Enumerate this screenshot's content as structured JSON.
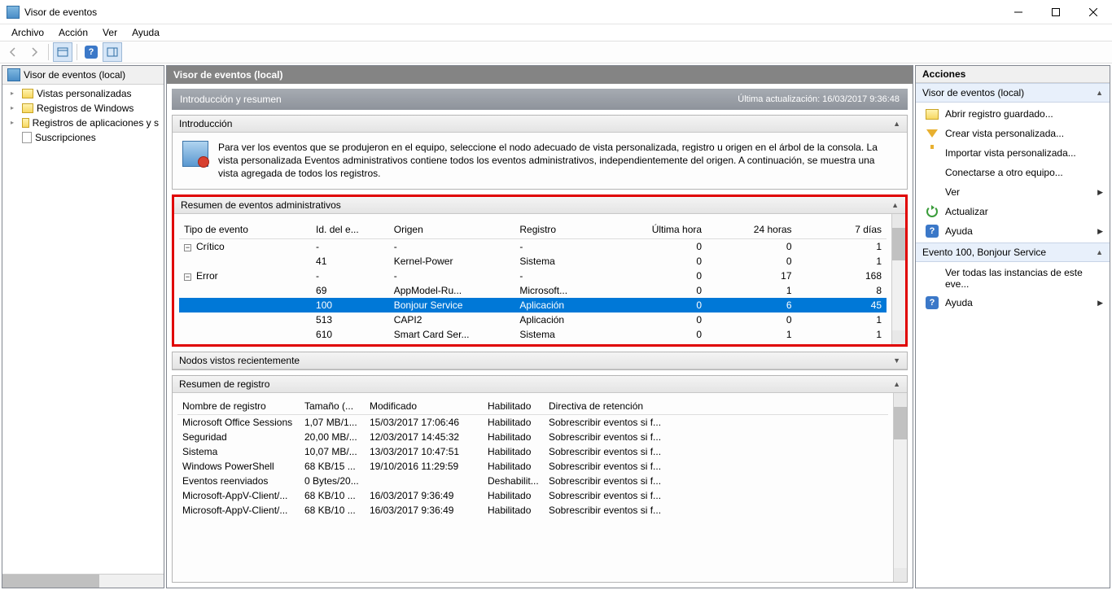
{
  "window": {
    "title": "Visor de eventos"
  },
  "menu": {
    "archivo": "Archivo",
    "accion": "Acción",
    "ver": "Ver",
    "ayuda": "Ayuda"
  },
  "tree": {
    "root": "Visor de eventos (local)",
    "items": [
      "Vistas personalizadas",
      "Registros de Windows",
      "Registros de aplicaciones y s",
      "Suscripciones"
    ]
  },
  "center": {
    "header": "Visor de eventos (local)",
    "title": "Introducción y resumen",
    "last_update": "Última actualización: 16/03/2017 9:36:48",
    "intro_header": "Introducción",
    "intro_text": "Para ver los eventos que se produjeron en el equipo, seleccione el nodo adecuado de vista personalizada, registro u origen en el árbol de la consola. La vista personalizada Eventos administrativos contiene todos los eventos administrativos, independientemente del origen. A continuación, se muestra una vista agregada de todos los registros.",
    "admin_summary_header": "Resumen de eventos administrativos",
    "admin_cols": {
      "tipo": "Tipo de evento",
      "id": "Id. del e...",
      "origen": "Origen",
      "registro": "Registro",
      "ultima": "Última hora",
      "h24": "24 horas",
      "d7": "7 días"
    },
    "admin_rows": [
      {
        "tipo": "Crítico",
        "id": "-",
        "origen": "-",
        "registro": "-",
        "ultima": "0",
        "h24": "0",
        "d7": "1",
        "expand": true
      },
      {
        "tipo": "",
        "id": "41",
        "origen": "Kernel-Power",
        "registro": "Sistema",
        "ultima": "0",
        "h24": "0",
        "d7": "1"
      },
      {
        "tipo": "Error",
        "id": "-",
        "origen": "-",
        "registro": "-",
        "ultima": "0",
        "h24": "17",
        "d7": "168",
        "expand": true
      },
      {
        "tipo": "",
        "id": "69",
        "origen": "AppModel-Ru...",
        "registro": "Microsoft...",
        "ultima": "0",
        "h24": "1",
        "d7": "8"
      },
      {
        "tipo": "",
        "id": "100",
        "origen": "Bonjour Service",
        "registro": "Aplicación",
        "ultima": "0",
        "h24": "6",
        "d7": "45",
        "selected": true
      },
      {
        "tipo": "",
        "id": "513",
        "origen": "CAPI2",
        "registro": "Aplicación",
        "ultima": "0",
        "h24": "0",
        "d7": "1"
      },
      {
        "tipo": "",
        "id": "610",
        "origen": "Smart Card Ser...",
        "registro": "Sistema",
        "ultima": "0",
        "h24": "1",
        "d7": "1"
      }
    ],
    "recent_nodes_header": "Nodos vistos recientemente",
    "reg_summary_header": "Resumen de registro",
    "reg_cols": {
      "nombre": "Nombre de registro",
      "tam": "Tamaño (...",
      "mod": "Modificado",
      "hab": "Habilitado",
      "dir": "Directiva de retención"
    },
    "reg_rows": [
      {
        "nombre": "Microsoft Office Sessions",
        "tam": "1,07 MB/1...",
        "mod": "15/03/2017 17:06:46",
        "hab": "Habilitado",
        "dir": "Sobrescribir eventos si f..."
      },
      {
        "nombre": "Seguridad",
        "tam": "20,00 MB/...",
        "mod": "12/03/2017 14:45:32",
        "hab": "Habilitado",
        "dir": "Sobrescribir eventos si f..."
      },
      {
        "nombre": "Sistema",
        "tam": "10,07 MB/...",
        "mod": "13/03/2017 10:47:51",
        "hab": "Habilitado",
        "dir": "Sobrescribir eventos si f..."
      },
      {
        "nombre": "Windows PowerShell",
        "tam": "68 KB/15 ...",
        "mod": "19/10/2016 11:29:59",
        "hab": "Habilitado",
        "dir": "Sobrescribir eventos si f..."
      },
      {
        "nombre": "Eventos reenviados",
        "tam": "0 Bytes/20...",
        "mod": "",
        "hab": "Deshabilit...",
        "dir": "Sobrescribir eventos si f..."
      },
      {
        "nombre": "Microsoft-AppV-Client/...",
        "tam": "68 KB/10 ...",
        "mod": "16/03/2017 9:36:49",
        "hab": "Habilitado",
        "dir": "Sobrescribir eventos si f..."
      },
      {
        "nombre": "Microsoft-AppV-Client/...",
        "tam": "68 KB/10 ...",
        "mod": "16/03/2017 9:36:49",
        "hab": "Habilitado",
        "dir": "Sobrescribir eventos si f..."
      }
    ]
  },
  "actions": {
    "header": "Acciones",
    "group1_title": "Visor de eventos (local)",
    "items1": [
      {
        "label": "Abrir registro guardado...",
        "icon": "folder"
      },
      {
        "label": "Crear vista personalizada...",
        "icon": "funnel"
      },
      {
        "label": "Importar vista personalizada...",
        "icon": "blank"
      },
      {
        "label": "Conectarse a otro equipo...",
        "icon": "blank"
      },
      {
        "label": "Ver",
        "icon": "blank",
        "submenu": true
      },
      {
        "label": "Actualizar",
        "icon": "refresh"
      },
      {
        "label": "Ayuda",
        "icon": "help",
        "submenu": true
      }
    ],
    "group2_title": "Evento 100, Bonjour Service",
    "items2": [
      {
        "label": "Ver todas las instancias de este eve...",
        "icon": "blank"
      },
      {
        "label": "Ayuda",
        "icon": "help",
        "submenu": true
      }
    ]
  }
}
